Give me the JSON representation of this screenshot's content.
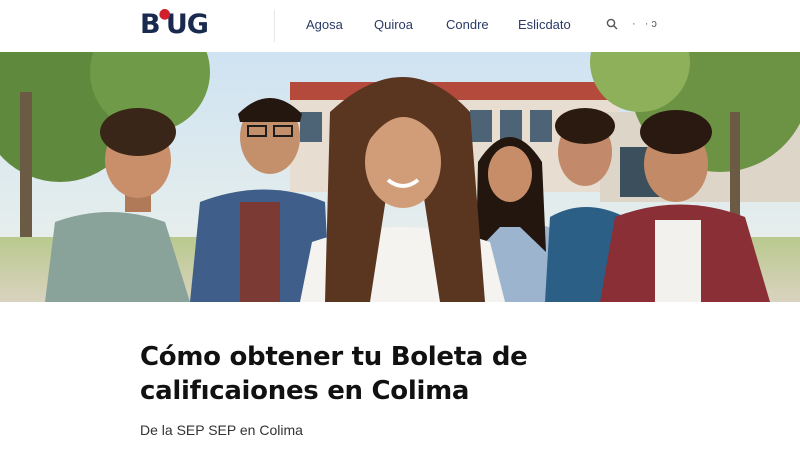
{
  "header": {
    "logo_text": "BjUG",
    "nav": [
      "Agosa",
      "Quiroa",
      "Condre",
      "Eslicdato"
    ],
    "util_text": "· ·ɔ"
  },
  "hero": {
    "image_desc_icon": "hero-photo"
  },
  "article": {
    "title": "Cómo obtener tu Boleta de califıcaiones en Colima",
    "subtitle": "De la SEP  SEP en Colima"
  },
  "colors": {
    "brand": "#1a2a4f",
    "accent": "#d11f2b",
    "nav_text": "#2b3a67"
  }
}
